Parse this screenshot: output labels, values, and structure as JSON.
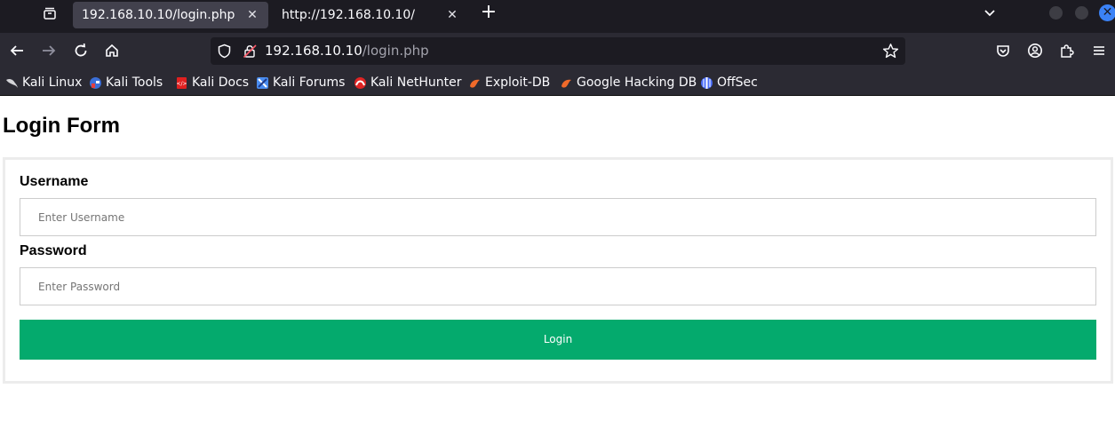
{
  "tabs": [
    {
      "title": "192.168.10.10/login.php",
      "active": true
    },
    {
      "title": "http://192.168.10.10/",
      "active": false
    }
  ],
  "tab_close_glyph": "✕",
  "new_tab_glyph": "+",
  "url": {
    "host": "192.168.10.10",
    "path": "/login.php"
  },
  "bookmarks": [
    {
      "label": "Kali Linux",
      "icon": "kali-dragon-icon"
    },
    {
      "label": "Kali Tools",
      "icon": "kali-tools-icon"
    },
    {
      "label": "Kali Docs",
      "icon": "kali-docs-icon"
    },
    {
      "label": "Kali Forums",
      "icon": "kali-forums-icon"
    },
    {
      "label": "Kali NetHunter",
      "icon": "nethunter-icon"
    },
    {
      "label": "Exploit-DB",
      "icon": "exploit-db-icon"
    },
    {
      "label": "Google Hacking DB",
      "icon": "ghdb-icon"
    },
    {
      "label": "OffSec",
      "icon": "offsec-icon"
    }
  ],
  "page": {
    "title": "Login Form",
    "username_label": "Username",
    "username_placeholder": "Enter Username",
    "password_label": "Password",
    "password_placeholder": "Enter Password",
    "login_button": "Login"
  },
  "colors": {
    "login_button": "#04aa6d",
    "window_close": "#3b82f6",
    "tabbar_bg": "#1c1b22",
    "toolbar_bg": "#2b2a33"
  }
}
